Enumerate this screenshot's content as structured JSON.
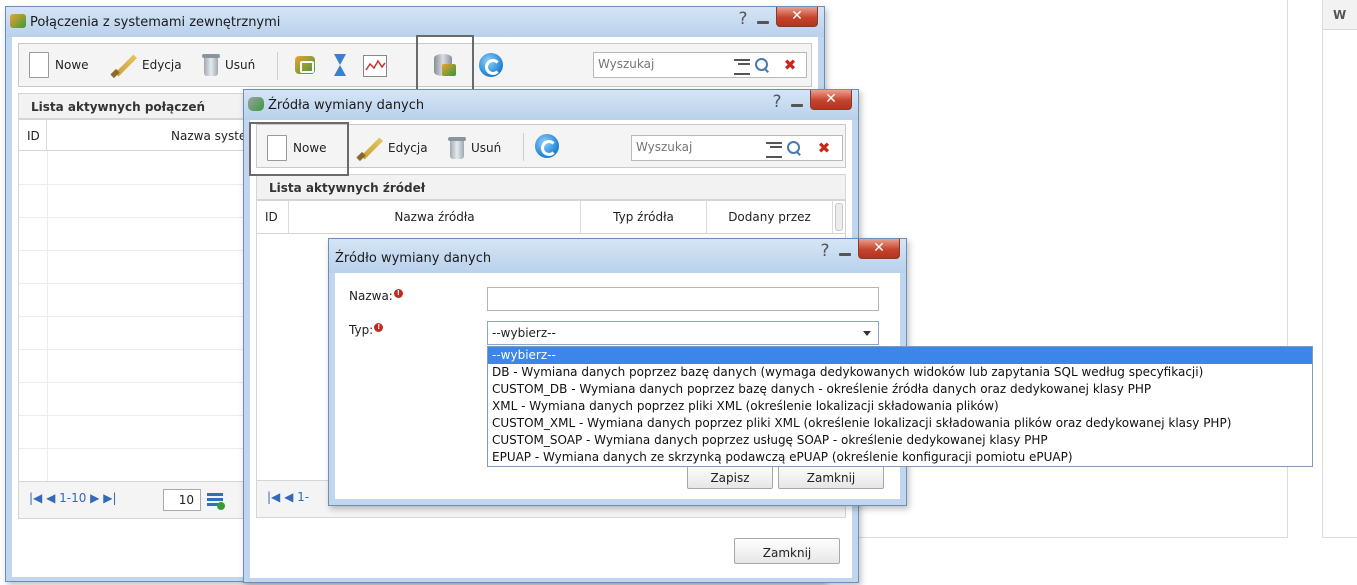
{
  "main_window": {
    "title": "Połączenia z systemami zewnętrznymi",
    "toolbar": {
      "new_label": "Nowe",
      "edit_label": "Edycja",
      "delete_label": "Usuń",
      "search_placeholder": "Wyszukaj"
    },
    "grid_title": "Lista aktywnych połączeń",
    "columns": [
      "ID",
      "Nazwa syste"
    ],
    "pager": {
      "nav": "|◀ ◀ 1-10 ▶ ▶|",
      "page_size": "10"
    },
    "icons": [
      "sync-icon",
      "hourglass-icon",
      "chart-icon",
      "database-icon",
      "refresh-icon"
    ]
  },
  "sources_window": {
    "title": "Źródła wymiany danych",
    "toolbar": {
      "new_label": "Nowe",
      "edit_label": "Edycja",
      "delete_label": "Usuń",
      "search_placeholder": "Wyszukaj"
    },
    "grid_title": "Lista aktywnych źródeł",
    "columns": [
      "ID",
      "Nazwa źródła",
      "Typ źródła",
      "Dodany przez"
    ],
    "pager": {
      "nav": "|◀ ◀ 1-"
    },
    "close_label": "Zamknij"
  },
  "dialog": {
    "title": "Źródło wymiany danych",
    "name_label": "Nazwa:",
    "name_value": "",
    "type_label": "Typ:",
    "type_selected": "--wybierz--",
    "options": [
      "--wybierz--",
      "DB - Wymiana danych poprzez bazę danych (wymaga dedykowanych widoków lub zapytania SQL według specyfikacji)",
      "CUSTOM_DB - Wymiana danych poprzez bazę danych - określenie źródła danych oraz dedykowanej klasy PHP",
      "XML - Wymiana danych poprzez pliki XML (określenie lokalizacji składowania plików)",
      "CUSTOM_XML - Wymiana danych poprzez pliki XML (określenie lokalizacji składowania plików oraz dedykowanej klasy PHP)",
      "CUSTOM_SOAP - Wymiana danych poprzez usługę SOAP - określenie dedykowanej klasy PHP",
      "EPUAP - Wymiana danych ze skrzynką podawczą ePUAP (określenie konfiguracji pomiotu ePUAP)"
    ],
    "save_label": "Zapisz",
    "close_label": "Zamknij"
  },
  "background": {
    "panel_header": "W"
  },
  "colors": {
    "title_bar": "#bfd6ee",
    "selection": "#3b86e8",
    "close_button": "#c6442c",
    "required": "#c8281a"
  }
}
